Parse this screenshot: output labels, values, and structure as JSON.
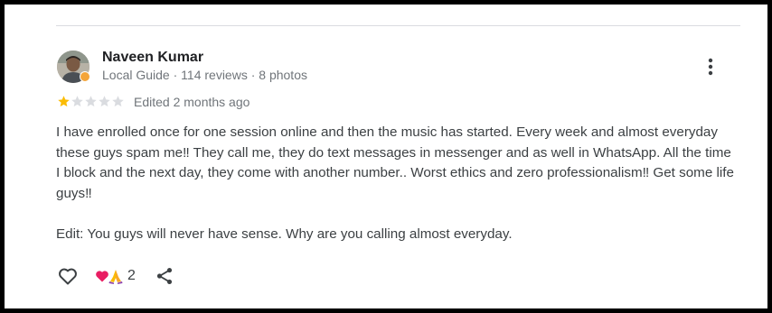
{
  "review": {
    "author": {
      "name": "Naveen Kumar",
      "meta": "Local Guide · 114 reviews · 8 photos"
    },
    "rating": 1,
    "max_rating": 5,
    "edited": "Edited 2 months ago",
    "paragraphs": [
      "I have enrolled once for one session online and then the music has started. Every week and almost everyday these guys spam me‼ They call me, they do text messages in messenger and as well in WhatsApp. All the time I block and the next day, they come with another number.. Worst ethics and zero professionalism‼ Get some life guys‼",
      "Edit: You guys will never have sense. Why are you calling almost everyday."
    ],
    "reaction_count": "2",
    "reactions": [
      "heart-emoji",
      "praying-hands-emoji"
    ]
  },
  "colors": {
    "star_filled": "#fbbc04",
    "star_empty": "#dadce0",
    "text_secondary": "#70757a",
    "text_body": "#3c4043",
    "local_guide_badge": "#f4a53a"
  },
  "icons": {
    "more": "more-vert-icon",
    "like": "heart-outline-icon",
    "share": "share-icon"
  }
}
